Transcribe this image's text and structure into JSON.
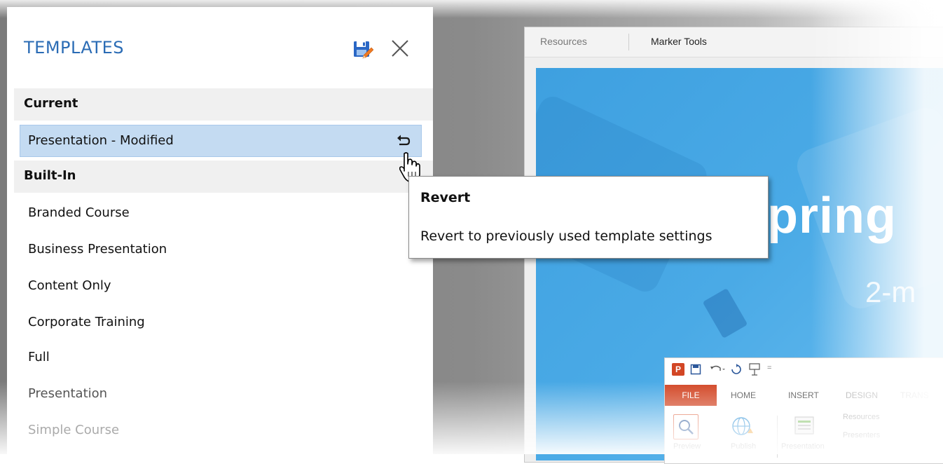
{
  "panel": {
    "title": "TEMPLATES",
    "sections": {
      "current": "Current",
      "builtin": "Built-In"
    },
    "current_item": "Presentation - Modified",
    "builtin_items": [
      "Branded Course",
      "Business Presentation",
      "Content Only",
      "Corporate Training",
      "Full",
      "Presentation",
      "Simple Course"
    ]
  },
  "tooltip": {
    "title": "Revert",
    "body": "Revert to previously used template settings"
  },
  "player": {
    "tabs": [
      "Resources",
      "Marker Tools"
    ],
    "slide_title": "pring",
    "slide_subtitle": "2-m"
  },
  "ppt": {
    "logo": "P",
    "tabs": [
      "FILE",
      "HOME",
      "INSERT",
      "DESIGN",
      "TRANS"
    ],
    "group_items": [
      "Resources",
      "Presenters"
    ],
    "button_labels": [
      "Preview",
      "Publish",
      "Presentation"
    ]
  },
  "colors": {
    "title_blue": "#2b6cb5",
    "selection": "#c4dbf2",
    "ppt_orange": "#d24625",
    "slide_blue": "#4aaae6"
  },
  "icons": {
    "save": "save-edit-icon",
    "close": "close-icon",
    "revert": "revert-icon",
    "cursor": "hand-pointer-icon"
  }
}
